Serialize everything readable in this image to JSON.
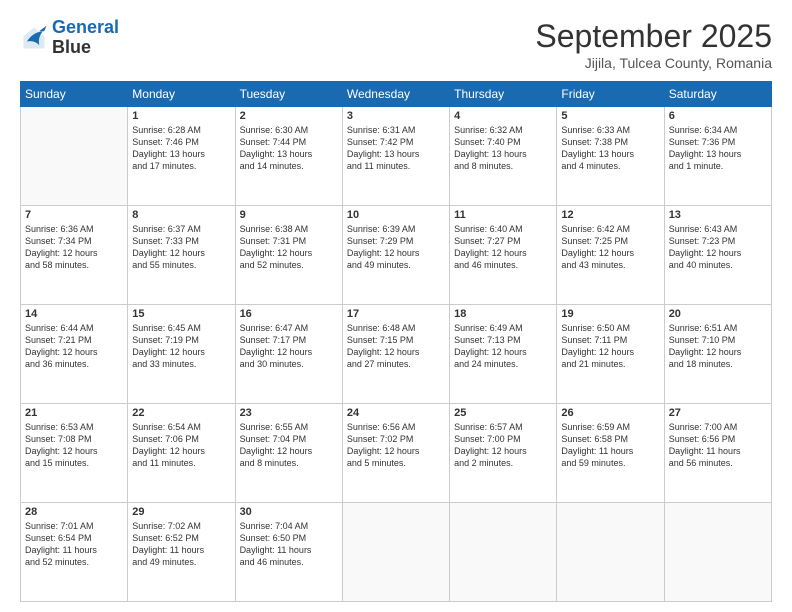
{
  "logo": {
    "line1": "General",
    "line2": "Blue"
  },
  "header": {
    "month": "September 2025",
    "location": "Jijila, Tulcea County, Romania"
  },
  "weekdays": [
    "Sunday",
    "Monday",
    "Tuesday",
    "Wednesday",
    "Thursday",
    "Friday",
    "Saturday"
  ],
  "weeks": [
    [
      {
        "day": "",
        "info": ""
      },
      {
        "day": "1",
        "info": "Sunrise: 6:28 AM\nSunset: 7:46 PM\nDaylight: 13 hours\nand 17 minutes."
      },
      {
        "day": "2",
        "info": "Sunrise: 6:30 AM\nSunset: 7:44 PM\nDaylight: 13 hours\nand 14 minutes."
      },
      {
        "day": "3",
        "info": "Sunrise: 6:31 AM\nSunset: 7:42 PM\nDaylight: 13 hours\nand 11 minutes."
      },
      {
        "day": "4",
        "info": "Sunrise: 6:32 AM\nSunset: 7:40 PM\nDaylight: 13 hours\nand 8 minutes."
      },
      {
        "day": "5",
        "info": "Sunrise: 6:33 AM\nSunset: 7:38 PM\nDaylight: 13 hours\nand 4 minutes."
      },
      {
        "day": "6",
        "info": "Sunrise: 6:34 AM\nSunset: 7:36 PM\nDaylight: 13 hours\nand 1 minute."
      }
    ],
    [
      {
        "day": "7",
        "info": "Sunrise: 6:36 AM\nSunset: 7:34 PM\nDaylight: 12 hours\nand 58 minutes."
      },
      {
        "day": "8",
        "info": "Sunrise: 6:37 AM\nSunset: 7:33 PM\nDaylight: 12 hours\nand 55 minutes."
      },
      {
        "day": "9",
        "info": "Sunrise: 6:38 AM\nSunset: 7:31 PM\nDaylight: 12 hours\nand 52 minutes."
      },
      {
        "day": "10",
        "info": "Sunrise: 6:39 AM\nSunset: 7:29 PM\nDaylight: 12 hours\nand 49 minutes."
      },
      {
        "day": "11",
        "info": "Sunrise: 6:40 AM\nSunset: 7:27 PM\nDaylight: 12 hours\nand 46 minutes."
      },
      {
        "day": "12",
        "info": "Sunrise: 6:42 AM\nSunset: 7:25 PM\nDaylight: 12 hours\nand 43 minutes."
      },
      {
        "day": "13",
        "info": "Sunrise: 6:43 AM\nSunset: 7:23 PM\nDaylight: 12 hours\nand 40 minutes."
      }
    ],
    [
      {
        "day": "14",
        "info": "Sunrise: 6:44 AM\nSunset: 7:21 PM\nDaylight: 12 hours\nand 36 minutes."
      },
      {
        "day": "15",
        "info": "Sunrise: 6:45 AM\nSunset: 7:19 PM\nDaylight: 12 hours\nand 33 minutes."
      },
      {
        "day": "16",
        "info": "Sunrise: 6:47 AM\nSunset: 7:17 PM\nDaylight: 12 hours\nand 30 minutes."
      },
      {
        "day": "17",
        "info": "Sunrise: 6:48 AM\nSunset: 7:15 PM\nDaylight: 12 hours\nand 27 minutes."
      },
      {
        "day": "18",
        "info": "Sunrise: 6:49 AM\nSunset: 7:13 PM\nDaylight: 12 hours\nand 24 minutes."
      },
      {
        "day": "19",
        "info": "Sunrise: 6:50 AM\nSunset: 7:11 PM\nDaylight: 12 hours\nand 21 minutes."
      },
      {
        "day": "20",
        "info": "Sunrise: 6:51 AM\nSunset: 7:10 PM\nDaylight: 12 hours\nand 18 minutes."
      }
    ],
    [
      {
        "day": "21",
        "info": "Sunrise: 6:53 AM\nSunset: 7:08 PM\nDaylight: 12 hours\nand 15 minutes."
      },
      {
        "day": "22",
        "info": "Sunrise: 6:54 AM\nSunset: 7:06 PM\nDaylight: 12 hours\nand 11 minutes."
      },
      {
        "day": "23",
        "info": "Sunrise: 6:55 AM\nSunset: 7:04 PM\nDaylight: 12 hours\nand 8 minutes."
      },
      {
        "day": "24",
        "info": "Sunrise: 6:56 AM\nSunset: 7:02 PM\nDaylight: 12 hours\nand 5 minutes."
      },
      {
        "day": "25",
        "info": "Sunrise: 6:57 AM\nSunset: 7:00 PM\nDaylight: 12 hours\nand 2 minutes."
      },
      {
        "day": "26",
        "info": "Sunrise: 6:59 AM\nSunset: 6:58 PM\nDaylight: 11 hours\nand 59 minutes."
      },
      {
        "day": "27",
        "info": "Sunrise: 7:00 AM\nSunset: 6:56 PM\nDaylight: 11 hours\nand 56 minutes."
      }
    ],
    [
      {
        "day": "28",
        "info": "Sunrise: 7:01 AM\nSunset: 6:54 PM\nDaylight: 11 hours\nand 52 minutes."
      },
      {
        "day": "29",
        "info": "Sunrise: 7:02 AM\nSunset: 6:52 PM\nDaylight: 11 hours\nand 49 minutes."
      },
      {
        "day": "30",
        "info": "Sunrise: 7:04 AM\nSunset: 6:50 PM\nDaylight: 11 hours\nand 46 minutes."
      },
      {
        "day": "",
        "info": ""
      },
      {
        "day": "",
        "info": ""
      },
      {
        "day": "",
        "info": ""
      },
      {
        "day": "",
        "info": ""
      }
    ]
  ]
}
